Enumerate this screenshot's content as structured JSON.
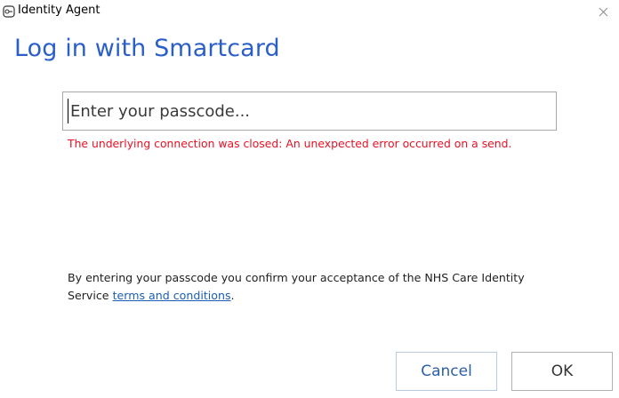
{
  "window": {
    "title": "Identity Agent",
    "icons": {
      "app": "smartcard-agent-icon",
      "close": "close-icon"
    }
  },
  "dialog": {
    "heading": "Log in with Smartcard",
    "passcode": {
      "value": "",
      "placeholder": "Enter your passcode..."
    },
    "error": "The underlying connection was closed: An unexpected error occurred on a send.",
    "terms": {
      "text": "By entering your passcode you confirm your acceptance of the NHS Care Identity Service ",
      "link_text": "terms and conditions",
      "suffix": "."
    },
    "buttons": {
      "cancel": "Cancel",
      "ok": "OK"
    }
  },
  "colors": {
    "heading": "#2b5fc8",
    "error": "#e81123",
    "link": "#1a5fb4",
    "cancel_text": "#2b5fa8"
  }
}
